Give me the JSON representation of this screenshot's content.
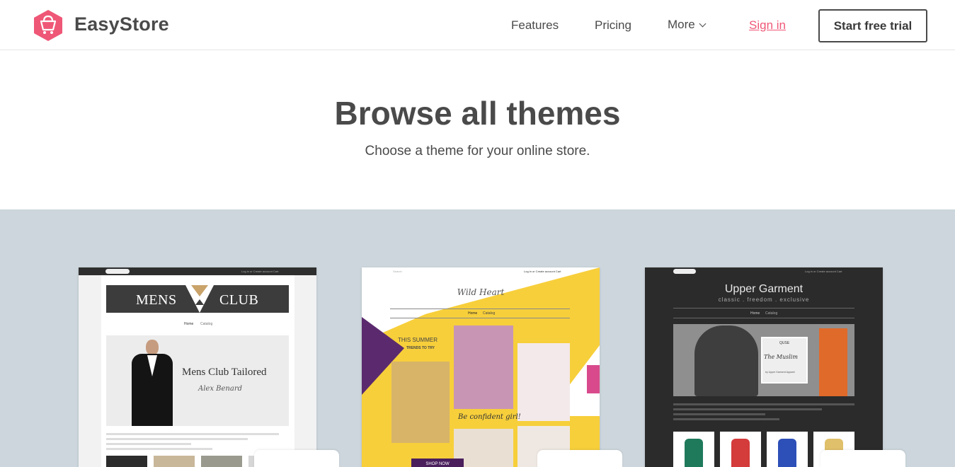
{
  "brand": {
    "name": "EasyStore",
    "accent": "#ef5777",
    "logo_icon": "shopping-bag-icon"
  },
  "nav": {
    "features": "Features",
    "pricing": "Pricing",
    "more": "More",
    "signin": "Sign in",
    "cta": "Start free trial"
  },
  "hero": {
    "title": "Browse all themes",
    "subtitle": "Choose a theme for your online store."
  },
  "themes": [
    {
      "name": "Mens Club",
      "preview": {
        "banner_left": "MENS",
        "banner_right": "CLUB",
        "nav": [
          "Home",
          "Catalog"
        ],
        "headline": "Mens Club Tailored",
        "signature": "Alex Benard",
        "top_links": "Log in  or  Create account   Cart"
      }
    },
    {
      "name": "Wild Heart",
      "preview": {
        "logo": "Wild Heart",
        "nav": [
          "Home",
          "Catalog"
        ],
        "promo": "THIS SUMMER",
        "promo_sub": "TRENDS TO TRY",
        "script": "Be confident girl!",
        "button": "SHOP NOW",
        "top_links": "Log in  or  Create account   Cart",
        "search": "Search"
      }
    },
    {
      "name": "Upper Garment",
      "preview": {
        "title": "Upper Garment",
        "tagline": "classic . freedom . exclusive",
        "nav": [
          "Home",
          "Catalog"
        ],
        "card_title": "The Muslim",
        "card_brand": "QUSE",
        "card_by": "by Upper Garment Apparel",
        "top_links": "Log in  or  Create account   Cart"
      }
    }
  ]
}
